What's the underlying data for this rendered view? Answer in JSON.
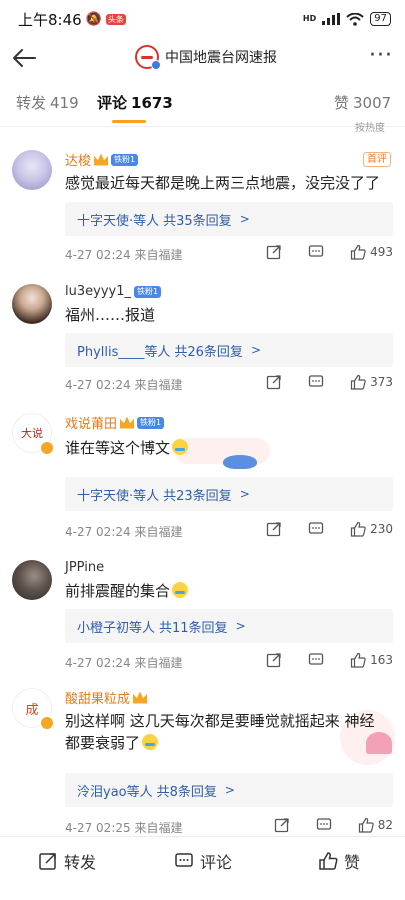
{
  "status_bar": {
    "time": "上午8:46",
    "app_badge": "头条",
    "battery": "97",
    "network": "HD"
  },
  "nav": {
    "title": "中国地震台网速报"
  },
  "tabs": [
    {
      "label": "转发",
      "count": "419"
    },
    {
      "label": "评论",
      "count": "1673"
    },
    {
      "label": "赞",
      "count": "3007"
    }
  ],
  "sort_hint": "按热度",
  "comments": [
    {
      "name": "达梭",
      "badge": "铁粉1",
      "tag": "首评",
      "text": "感觉最近每天都是晚上两三点地震，没完没了了",
      "reply": "十字天使·等人",
      "reply_count": "共35条回复",
      "meta": "4-27 02:24  来自福建",
      "likes": "493"
    },
    {
      "name": "lu3eyyy1_",
      "badge": "铁粉1",
      "text": "福州……报道",
      "reply": "Phyllis____等人",
      "reply_count": "共26条回复",
      "meta": "4-27 02:24  来自福建",
      "likes": "373"
    },
    {
      "name": "戏说莆田",
      "badge": "铁粉1",
      "text": "谁在等这个博文",
      "reply": "十字天使·等人",
      "reply_count": "共23条回复",
      "meta": "4-27 02:24  来自福建",
      "likes": "230"
    },
    {
      "name": "JPPine",
      "text": "前排震醒的集合",
      "reply": "小橙子初等人",
      "reply_count": "共11条回复",
      "meta": "4-27 02:24  来自福建",
      "likes": "163"
    },
    {
      "name": "酸甜果粒成",
      "text_line1": "别这样啊 这几天每次都是要睡觉就摇起来 神经",
      "text_line2": "都要衰弱了",
      "reply": "泠泪yao等人",
      "reply_count": "共8条回复",
      "meta": "4-27 02:25  来自福建",
      "likes": "82"
    }
  ],
  "bottom_bar": {
    "repost": "转发",
    "comment": "评论",
    "like": "赞"
  }
}
